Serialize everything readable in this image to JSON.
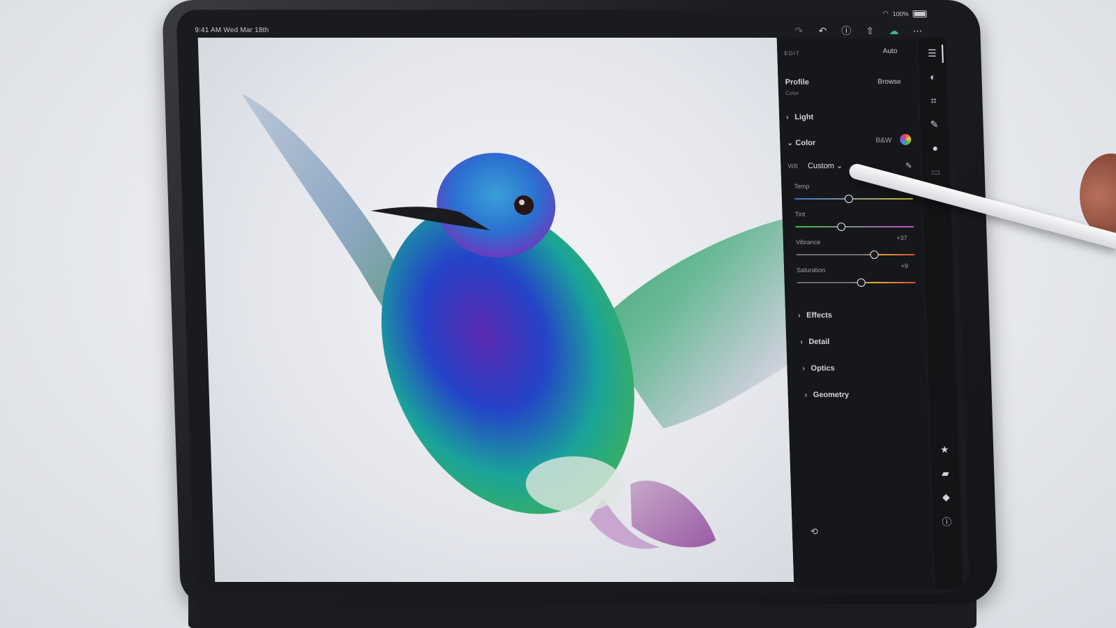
{
  "status_bar": {
    "time_date": "9:41 AM  Wed Mar 18th",
    "battery": "100%"
  },
  "toolbar": {
    "icons": [
      "redo-icon",
      "undo-icon",
      "help-icon",
      "share-icon",
      "cloud-sync-icon",
      "more-icon"
    ]
  },
  "panel": {
    "edit_label": "EDIT",
    "auto_label": "Auto",
    "profile_label": "Profile",
    "profile_value": "Color",
    "browse_label": "Browse",
    "sections": {
      "light": "Light",
      "color": "Color",
      "effects": "Effects",
      "detail": "Detail",
      "optics": "Optics",
      "geometry": "Geometry"
    },
    "bw_label": "B&W",
    "wb_label": "WB",
    "wb_value": "Custom",
    "sliders": [
      {
        "label": "Temp",
        "value": "",
        "position": 0.45
      },
      {
        "label": "Tint",
        "value": "",
        "position": 0.38
      },
      {
        "label": "Vibrance",
        "value": "+37",
        "position": 0.66
      },
      {
        "label": "Saturation",
        "value": "+9",
        "position": 0.54
      }
    ]
  },
  "rail": {
    "icons": [
      "edit-sliders-icon",
      "masking-icon",
      "crop-icon",
      "brush-icon",
      "healing-icon",
      "presets-icon",
      "star-icon",
      "comment-icon",
      "tag-icon",
      "info-icon",
      "history-icon"
    ]
  },
  "colors": {
    "panel_bg": "#16171a",
    "accent_green": "#3fb887",
    "text": "#d4d6da"
  }
}
